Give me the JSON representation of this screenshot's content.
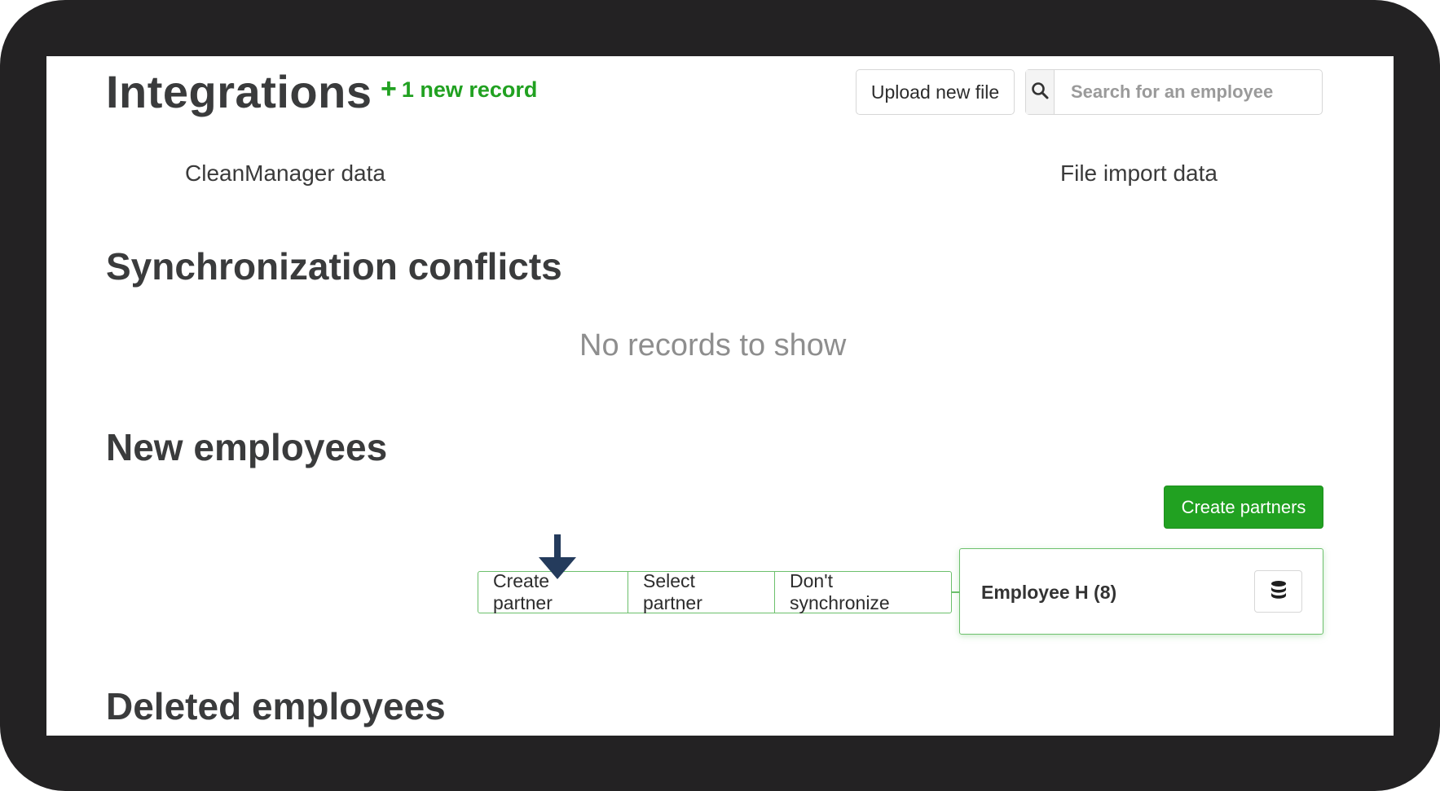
{
  "header": {
    "title": "Integrations",
    "new_record_plus": "+",
    "new_record_text": "1 new record",
    "upload_label": "Upload new file",
    "search_placeholder": "Search for an employee",
    "search_icon": "search-icon"
  },
  "columns": {
    "cleanmanager": "CleanManager data",
    "file_import": "File import data"
  },
  "sync_conflicts": {
    "title": "Synchronization conflicts",
    "empty_text": "No records to show"
  },
  "new_employees": {
    "title": "New employees",
    "create_partners_label": "Create partners",
    "row": {
      "actions": [
        "Create partner",
        "Select partner",
        "Don't synchronize"
      ],
      "employee_name": "Employee H (8)",
      "database_icon": "database-icon"
    },
    "pointer_icon": "arrow-down-icon"
  },
  "deleted_employees": {
    "title": "Deleted employees"
  },
  "colors": {
    "accent_green": "#21a121",
    "border_green": "#6cc06c",
    "arrow_navy": "#243b5c",
    "bezel": "#232223"
  }
}
